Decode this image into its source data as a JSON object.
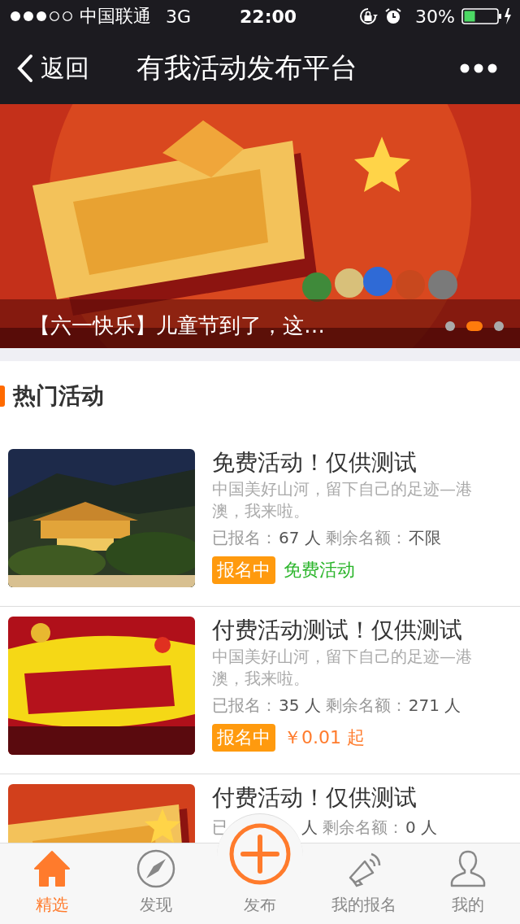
{
  "status_bar": {
    "carrier": "中国联通",
    "network": "3G",
    "time": "22:00",
    "battery": "30%"
  },
  "nav": {
    "back": "返回",
    "title": "有我活动发布平台"
  },
  "banner": {
    "caption": "【六一快乐】儿童节到了，这…",
    "dots": [
      {
        "selected": false
      },
      {
        "selected": true
      },
      {
        "selected": false
      }
    ]
  },
  "section": {
    "title": "热门活动"
  },
  "activities": [
    {
      "title": "免费活动！仅供测试",
      "description": "中国美好山河，留下自己的足迹—港澳，我来啦。",
      "stats": [
        {
          "kind": "label",
          "text": "已报名："
        },
        {
          "kind": "value",
          "text": "67 人"
        },
        {
          "kind": "label",
          "text": "剩余名额："
        },
        {
          "kind": "value",
          "text": "不限"
        }
      ],
      "status": "报名中",
      "price": {
        "kind": "free",
        "text": "免费活动"
      }
    },
    {
      "title": "付费活动测试！仅供测试",
      "description": "中国美好山河，留下自己的足迹—港澳，我来啦。",
      "stats": [
        {
          "kind": "label",
          "text": "已报名："
        },
        {
          "kind": "value",
          "text": "35 人"
        },
        {
          "kind": "label",
          "text": "剩余名额："
        },
        {
          "kind": "value",
          "text": "271 人"
        }
      ],
      "status": "报名中",
      "price": {
        "kind": "paid",
        "text": "￥0.01 起"
      }
    },
    {
      "title": "付费活动！仅供测试",
      "stats": [
        {
          "kind": "label",
          "text": "已"
        },
        {
          "kind": "hidden"
        },
        {
          "kind": "value",
          "text": "人"
        },
        {
          "kind": "label",
          "text": "剩余名额："
        },
        {
          "kind": "value",
          "text": "0 人"
        }
      ]
    }
  ],
  "tabs": [
    {
      "kind": "home",
      "label": "精选",
      "selected": true
    },
    {
      "kind": "discover",
      "label": "发现",
      "selected": false
    },
    {
      "kind": "publish",
      "label": "发布",
      "selected": false
    },
    {
      "kind": "signup",
      "label": "我的报名",
      "selected": false
    },
    {
      "kind": "me",
      "label": "我的",
      "selected": false
    }
  ]
}
